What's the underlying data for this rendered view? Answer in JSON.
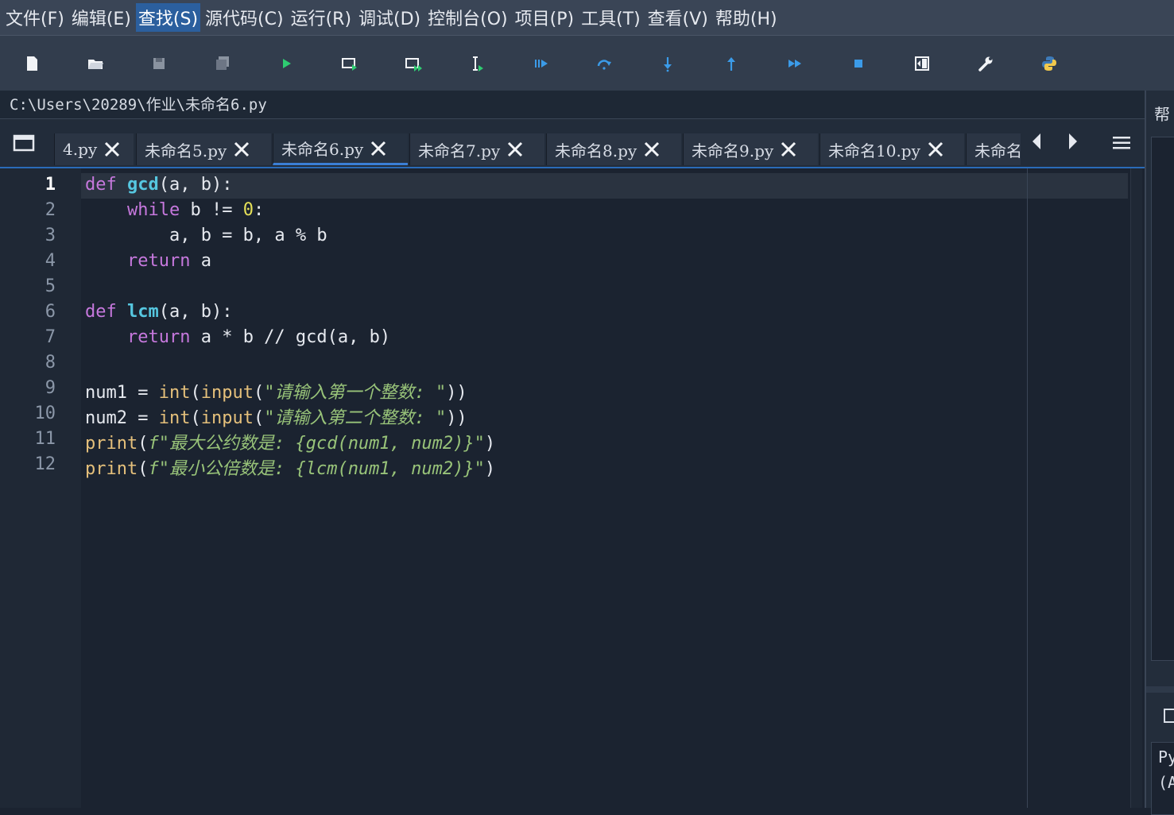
{
  "menubar": {
    "items": [
      {
        "label": "文件(F)"
      },
      {
        "label": "编辑(E)"
      },
      {
        "label": "查找(S)"
      },
      {
        "label": "源代码(C)"
      },
      {
        "label": "运行(R)"
      },
      {
        "label": "调试(D)"
      },
      {
        "label": "控制台(O)"
      },
      {
        "label": "项目(P)"
      },
      {
        "label": "工具(T)"
      },
      {
        "label": "查看(V)"
      },
      {
        "label": "帮助(H)"
      }
    ],
    "active_index": 2
  },
  "toolbar": {
    "buttons": [
      {
        "icon": "new-file-icon"
      },
      {
        "icon": "open-folder-icon"
      },
      {
        "icon": "save-icon"
      },
      {
        "icon": "save-all-icon"
      },
      {
        "icon": "run-icon"
      },
      {
        "icon": "run-cell-icon"
      },
      {
        "icon": "run-cell-advance-icon"
      },
      {
        "icon": "run-selection-icon"
      },
      {
        "icon": "debug-icon"
      },
      {
        "icon": "step-over-icon"
      },
      {
        "icon": "step-into-icon"
      },
      {
        "icon": "step-out-icon"
      },
      {
        "icon": "continue-icon"
      },
      {
        "icon": "stop-icon"
      },
      {
        "icon": "maximize-pane-icon"
      },
      {
        "icon": "preferences-icon"
      },
      {
        "icon": "python-path-icon"
      }
    ],
    "accent_run": "#2ecc71",
    "accent_debug": "#3b9be8"
  },
  "pathbar": {
    "path": "C:\\Users\\20289\\作业\\未命名6.py"
  },
  "tabs": {
    "items": [
      {
        "label": "4.py"
      },
      {
        "label": "未命名5.py"
      },
      {
        "label": "未命名6.py"
      },
      {
        "label": "未命名7.py"
      },
      {
        "label": "未命名8.py"
      },
      {
        "label": "未命名9.py"
      },
      {
        "label": "未命名10.py"
      },
      {
        "label": "未命名"
      }
    ],
    "active_index": 2
  },
  "editor": {
    "current_line": 1,
    "line_numbers": [
      "1",
      "2",
      "3",
      "4",
      "5",
      "6",
      "7",
      "8",
      "9",
      "10",
      "11",
      "12"
    ],
    "lines": [
      [
        [
          "kw",
          "def"
        ],
        [
          "",
          " "
        ],
        [
          "fn",
          "gcd"
        ],
        [
          "",
          "(a, b):"
        ]
      ],
      [
        [
          "",
          "    "
        ],
        [
          "kw",
          "while"
        ],
        [
          "",
          " b != "
        ],
        [
          "num",
          "0"
        ],
        [
          "",
          ":"
        ]
      ],
      [
        [
          "",
          "        a, b = b, a % b"
        ]
      ],
      [
        [
          "",
          "    "
        ],
        [
          "kw",
          "return"
        ],
        [
          "",
          " a"
        ]
      ],
      [],
      [
        [
          "kw",
          "def"
        ],
        [
          "",
          " "
        ],
        [
          "fn",
          "lcm"
        ],
        [
          "",
          "(a, b):"
        ]
      ],
      [
        [
          "",
          "    "
        ],
        [
          "kw",
          "return"
        ],
        [
          "",
          " a * b // gcd(a, b)"
        ]
      ],
      [],
      [
        [
          "",
          "num1 = "
        ],
        [
          "bi",
          "int"
        ],
        [
          "",
          "("
        ],
        [
          "bi",
          "input"
        ],
        [
          "",
          "("
        ],
        [
          "str",
          "\"请输入第一个整数: \""
        ],
        [
          "",
          "))"
        ]
      ],
      [
        [
          "",
          "num2 = "
        ],
        [
          "bi",
          "int"
        ],
        [
          "",
          "("
        ],
        [
          "bi",
          "input"
        ],
        [
          "",
          "("
        ],
        [
          "str",
          "\"请输入第二个整数: \""
        ],
        [
          "",
          "))"
        ]
      ],
      [
        [
          "bi",
          "print"
        ],
        [
          "",
          "("
        ],
        [
          "str",
          "f\"最大公约数是: {gcd(num1, num2)}\""
        ],
        [
          "",
          ")"
        ]
      ],
      [
        [
          "bi",
          "print"
        ],
        [
          "",
          "("
        ],
        [
          "str",
          "f\"最小公倍数是: {lcm(num1, num2)}\""
        ],
        [
          "",
          ")"
        ]
      ]
    ]
  },
  "right_panel": {
    "help_tab": "帮",
    "console_text_1": "Py",
    "console_text_2": "(A"
  }
}
